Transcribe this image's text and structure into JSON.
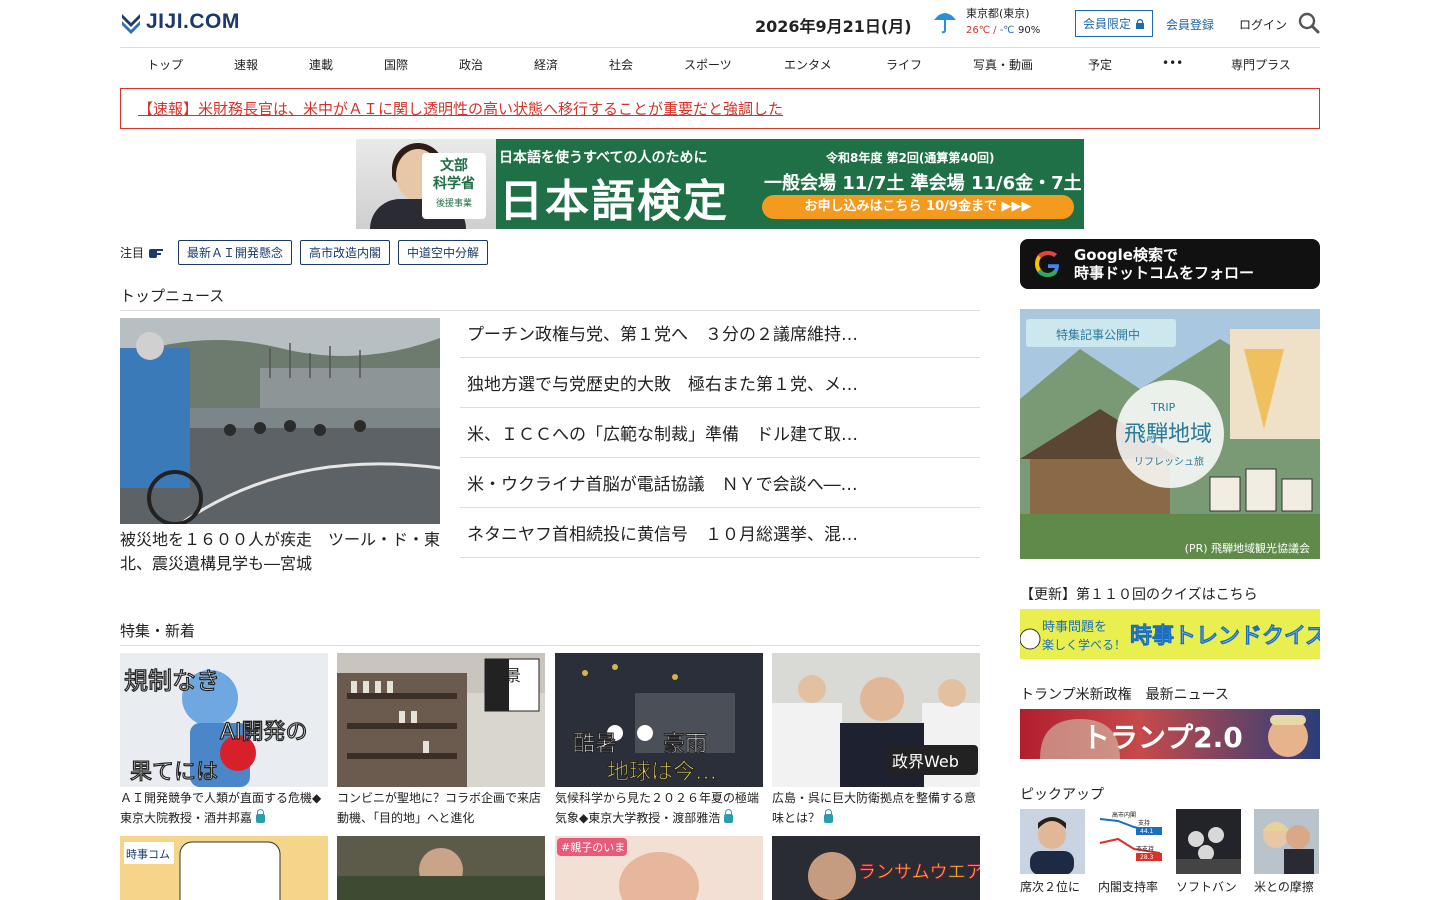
{
  "header": {
    "logo": "JIJI.COM",
    "date": "2026年9月21日(月)",
    "weather": {
      "place": "東京都(東京)",
      "high": "26℃",
      "sep": " / ",
      "low": "-℃",
      "rain": "90%",
      "icon": "umbrella-icon"
    },
    "member_only": "会員限定",
    "register": "会員登録",
    "login": "ログイン"
  },
  "nav": [
    "トップ",
    "速報",
    "連載",
    "国際",
    "政治",
    "経済",
    "社会",
    "スポーツ",
    "エンタメ",
    "ライフ",
    "写真・動画",
    "予定",
    "•••",
    "専門プラス"
  ],
  "breaking": "【速報】米財務長官は、米中がＡＩに関し透明性の高い状態へ移行することが重要だと強調した",
  "banner": {
    "tag1": "文部",
    "tag2": "科学省",
    "tag3": "後援事業",
    "sub": "日本語を使うすべての人のために",
    "main": "日本語検定",
    "round": "令和8年度 第2回(通算第40回)",
    "dates": "一般会場 11/7土 準会場 11/6金・7土",
    "cta": "お申し込みはこちら 10/9金まで ▶▶▶"
  },
  "attention": {
    "label": "注目",
    "tags": [
      "最新ＡＩ開発懸念",
      "高市改造内閣",
      "中道空中分解"
    ]
  },
  "top_news": {
    "heading": "トップニュース",
    "lead_caption": "被災地を１６００人が疾走　ツール・ド・東北、震災遺構見学も―宮城",
    "items": [
      "プーチン政権与党、第１党へ　３分の２議席維持…",
      "独地方選で与党歴史的大敗　極右また第１党、メ…",
      "米、ＩＣＣへの「広範な制裁」準備　ドル建て取…",
      "米・ウクライナ首脳が電話協議　ＮＹで会談へ―…",
      "ネタニヤフ首相続投に黄信号　１０月総選挙、混…"
    ]
  },
  "features": {
    "heading": "特集・新着",
    "items": [
      {
        "caption": "ＡＩ開発競争で人類が直面する危機◆東京大院教授・酒井邦嘉",
        "overlay": "規制なき\nAI開発の\n果てには",
        "locked": true
      },
      {
        "caption": "コンビニが聖地に？コラボ企画で来店動機、「目的地」へと進化",
        "overlay": "けいざい百景",
        "locked": false
      },
      {
        "caption": "気候科学から見た２０２６年夏の極端気象◆東京大学教授・渡部雅浩",
        "overlay": "酷暑　豪雨\n地球は今…",
        "locked": true
      },
      {
        "caption": "広島・呉に巨大防衛拠点を整備する意味とは？",
        "overlay": "政界Web",
        "locked": true
      },
      {
        "caption": "",
        "overlay": "時事コム",
        "locked": false
      },
      {
        "caption": "",
        "overlay": "",
        "locked": false
      },
      {
        "caption": "",
        "overlay": "#親子のいま",
        "locked": false
      },
      {
        "caption": "",
        "overlay": "ランサムウエア\n感染",
        "locked": false
      }
    ]
  },
  "sidebar": {
    "google_follow": "Google検索で\n時事ドットコムをフォロー",
    "hida": {
      "badge": "特集記事公開中",
      "trip": "TRIP",
      "title": "飛騨地域",
      "sub": "リフレッシュ旅",
      "pr": "(PR) 飛騨地域観光協議会"
    },
    "quiz_heading": "【更新】第１１０回のクイズはこちら",
    "quiz_banner": "時事問題を楽しく学べる！ 時事トレンドクイズ",
    "trump_heading": "トランプ米新政権　最新ニュース",
    "trump_banner": "トランプ2.0",
    "pick_heading": "ピックアップ",
    "picks": [
      "席次２位に",
      "内閣支持率",
      "ソフトバン",
      "米との摩擦"
    ],
    "poll": {
      "title": "高市内閣",
      "yes_label": "支持",
      "yes": "44.1",
      "no_label": "不支持",
      "no": "28.3"
    }
  },
  "colors": {
    "brand": "#1a3a6b",
    "breaking": "#d6332a",
    "link": "#1f6aa8"
  }
}
